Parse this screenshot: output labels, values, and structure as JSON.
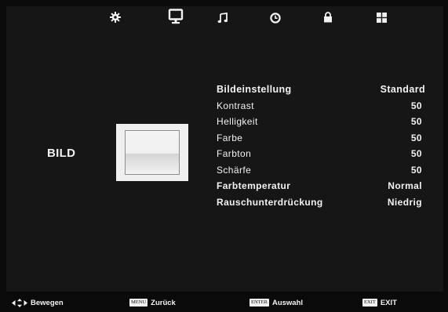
{
  "topbar": {
    "icons": [
      {
        "name": "settings-gear-icon"
      },
      {
        "name": "picture-monitor-icon",
        "active": true
      },
      {
        "name": "sound-note-icon"
      },
      {
        "name": "time-clock-icon"
      },
      {
        "name": "lock-icon"
      },
      {
        "name": "apps-grid-icon"
      }
    ]
  },
  "section": {
    "title": "BILD"
  },
  "settings": {
    "rows": [
      {
        "label": "Bildeinstellung",
        "value": "Standard"
      },
      {
        "label": "Kontrast",
        "value": "50"
      },
      {
        "label": "Helligkeit",
        "value": "50"
      },
      {
        "label": "Farbe",
        "value": "50"
      },
      {
        "label": "Farbton",
        "value": "50"
      },
      {
        "label": "Schärfe",
        "value": "50"
      },
      {
        "label": "Farbtemperatur",
        "value": "Normal"
      },
      {
        "label": "Rauschunterdrückung",
        "value": "Niedrig"
      }
    ]
  },
  "footer": {
    "move_label": "Bewegen",
    "menu_key": "MENU",
    "back_label": "Zurück",
    "enter_key": "ENTER",
    "select_label": "Auswahl",
    "exit_key": "EXIT",
    "exit_label": "EXIT"
  },
  "colors": {
    "background": "#0a0a0a",
    "panel": "#161616",
    "text": "#f2f2f2",
    "key_badge": "#f0f0f0"
  }
}
